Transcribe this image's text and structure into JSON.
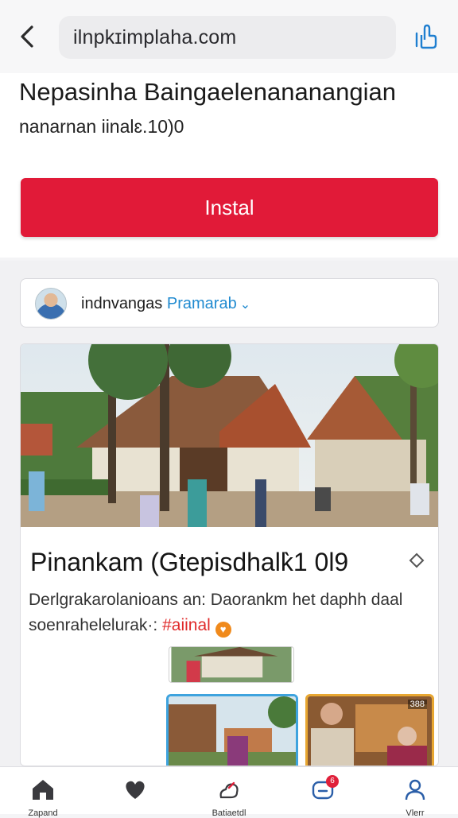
{
  "browser": {
    "url": "ilnpkɪimplaha.com",
    "back_icon": "chevron-left-icon",
    "share_icon": "share-icon"
  },
  "app": {
    "title": "Nepasinha Baingaelenananangian",
    "subtitle": "nanarnan iinalɛ.10)0",
    "install_label": "Instal",
    "install_color": "#e11a38"
  },
  "post": {
    "author_name": "indnvangas",
    "author_link": "Pramarab",
    "title": "Pinankam (Gtepisdhalk̀1 0l9",
    "body_text": "Derlgrakarolanioans an: Daorankm het daphh daal soenrahelelurak·: ",
    "hashtag": "#aiinal",
    "thumb3_badge": "388"
  },
  "tabs": [
    {
      "name": "home",
      "icon": "home-icon",
      "label": "Zapand"
    },
    {
      "name": "likes",
      "icon": "heart-icon",
      "label": ""
    },
    {
      "name": "activity",
      "icon": "activity-icon",
      "label": "Batiaetdl"
    },
    {
      "name": "messages",
      "icon": "message-icon",
      "label": "",
      "badge": "6"
    },
    {
      "name": "profile",
      "icon": "user-icon",
      "label": "Vlerr"
    }
  ],
  "colors": {
    "accent_red": "#e11a38",
    "link_blue": "#1f8ad0",
    "hashtag_red": "#e02a2a"
  }
}
